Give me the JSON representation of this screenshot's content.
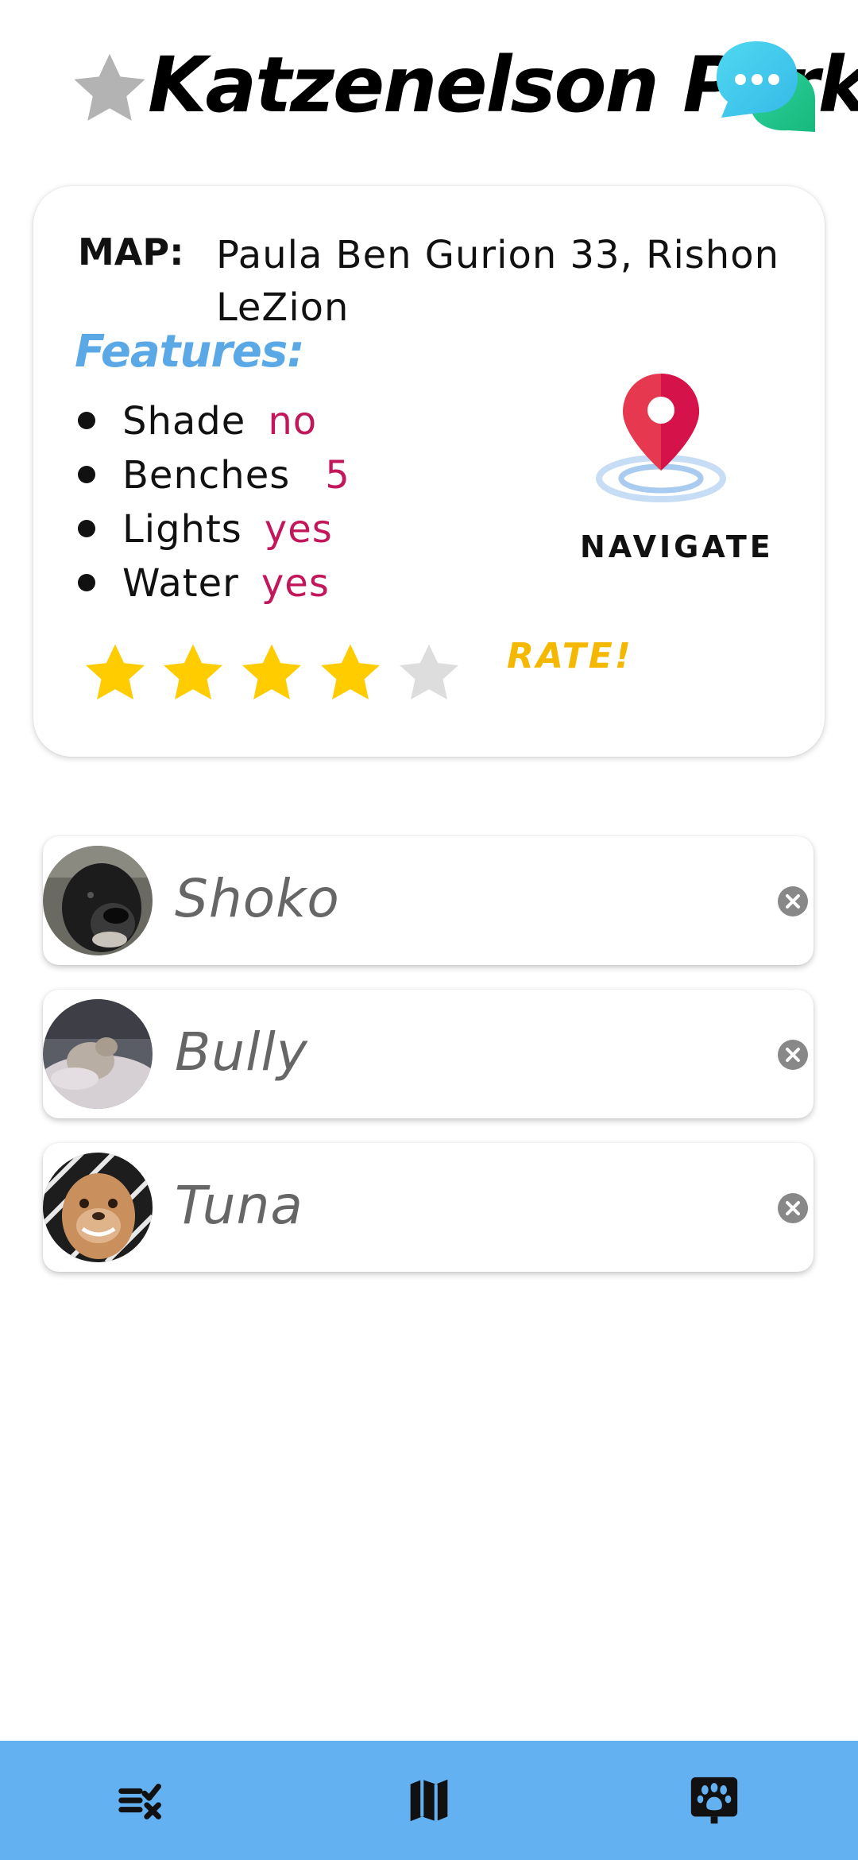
{
  "header": {
    "title": "Katzenelson Park",
    "favorite_icon": "star-icon",
    "chat_icon": "chat-bubbles-icon"
  },
  "info": {
    "map_label": "MAP:",
    "address": "Paula Ben Gurion 33, Rishon LeZion",
    "features_title": "Features:",
    "features": [
      {
        "name": "Shade",
        "value": "no"
      },
      {
        "name": "Benches",
        "value": "5"
      },
      {
        "name": "Lights",
        "value": "yes"
      },
      {
        "name": "Water",
        "value": "yes"
      }
    ],
    "navigate_label": "NAVIGATE",
    "rating": 4,
    "rating_max": 5,
    "rate_label": "RATE!"
  },
  "dogs": [
    {
      "name": "Shoko"
    },
    {
      "name": "Bully"
    },
    {
      "name": "Tuna"
    }
  ],
  "nav": {
    "items": [
      "checklist-icon",
      "map-icon",
      "paw-icon"
    ],
    "active": 2
  },
  "colors": {
    "accent_blue": "#64b1f2",
    "features_blue": "#5aa9e6",
    "value_magenta": "#c2185b",
    "star_gold": "#ffcc00",
    "star_empty": "#dddddd",
    "rate_gold": "#f5b800"
  }
}
